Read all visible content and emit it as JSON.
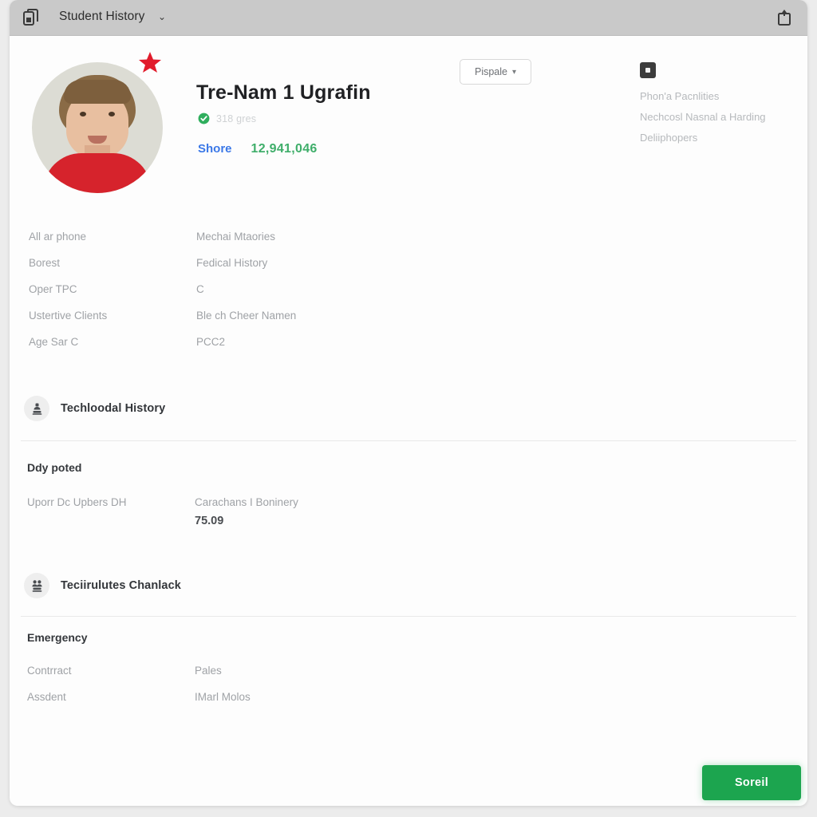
{
  "topbar": {
    "left_icon": "copy-document-icon",
    "title": "Student History",
    "chevron": "⌄",
    "right_icon": "upload-share-icon"
  },
  "profile": {
    "avatar_alt": "student-photo",
    "star_badge": "red-star-badge",
    "name": "Tre-Nam 1 Ugrafin",
    "verified_text": "318 gres",
    "stat_label": "Shore",
    "stat_value": "12,941,046",
    "dropdown_label": "Pispale",
    "dropdown_caret": "▾",
    "side_icon": "dark-square-icon",
    "side_lines": [
      "Phon'a Pacnlities",
      "Nechcosl Nasnal a  Harding",
      "Deliiphopers"
    ]
  },
  "info_grid": {
    "rows": [
      {
        "left": "All ar phone",
        "right": "Mechai Mtaories"
      },
      {
        "left": "Borest",
        "right": "Fedical History"
      },
      {
        "left": "Oper TPC",
        "right": "C"
      },
      {
        "left": "Ustertive Clients",
        "right": "Ble ch Cheer Namen"
      },
      {
        "left": "Age Sar C",
        "right": "PCC2"
      }
    ]
  },
  "section_one": {
    "icon": "stamp-icon",
    "title": "Techloodal History",
    "subheading": "Ddy poted",
    "detail_left": "Uporr Dc Upbers DH",
    "detail_right": "Carachans I Boninery",
    "detail_right_value": "75.09"
  },
  "section_two": {
    "icon": "contacts-icon",
    "title": "Teciirulutes Chanlack",
    "subheading": "Emergency",
    "rows": [
      {
        "left": "Contrract",
        "right": "Pales"
      },
      {
        "left": "Assdent",
        "right": "IMarl Molos"
      }
    ]
  },
  "footer": {
    "save_label": "Soreil"
  },
  "colors": {
    "accent_green": "#1ca54f",
    "link_blue": "#3b78e7",
    "value_green": "#3fae6a",
    "star_red": "#e11b2b",
    "topbar_gray": "#c9c9c9"
  }
}
